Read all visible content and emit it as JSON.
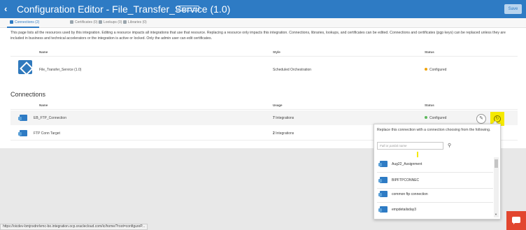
{
  "header": {
    "back_icon": "chevron-left-icon",
    "title": "Configuration Editor - File_Transfer_Service (1.0)",
    "badge": "INTEGRATION",
    "save_label": "Save"
  },
  "tabs": [
    {
      "label": "Connections (2)",
      "icon": "connections-icon"
    },
    {
      "label": "Certificates (0)",
      "icon": "certificate-icon"
    },
    {
      "label": "Lookups (0)",
      "icon": "lookup-icon"
    },
    {
      "label": "Libraries (0)",
      "icon": "library-icon"
    }
  ],
  "description": "This page lists all the resources used by this integration. Editing a resource impacts all integrations that use that resource. Replacing a resource only impacts this integration. Connections, libraries, lookups, and certificates can be edited. Connections and certificates (pgp keys) can be replaced unless they are included in business and technical accelerators or the integration is active or locked. Only the admin user can edit certificates.",
  "integration_table": {
    "columns": [
      "Name",
      "Style",
      "Status"
    ],
    "row": {
      "name": "File_Transfer_Service (1.0)",
      "style": "Scheduled Orchestration",
      "status": "Configured",
      "status_color": "#f0a30a"
    }
  },
  "connections": {
    "title": "Connections",
    "columns": [
      "Name",
      "Usage",
      "Status"
    ],
    "rows": [
      {
        "name": "EB_FTP_Connection",
        "usage_count": "7",
        "usage_label": "Integrations",
        "status": "Configured",
        "status_color": "#5cb85c"
      },
      {
        "name": "FTP Conn Target",
        "usage_count": "2",
        "usage_label": "Integrations",
        "status": "",
        "status_color": ""
      }
    ]
  },
  "replace_popup": {
    "text": "Replace this connection with a connection choosing from the following.",
    "search_placeholder": "Full or partial name",
    "search_value": "",
    "items": [
      "Aug22_Assignment",
      "BIPFTPCONNEC",
      "common ftp connection",
      "empdetailsday3"
    ]
  },
  "status_url": "https://oicdev-bmjnxdnrlvmc-bo.integration.ocp.oraclecloud.com/ic/home/?root=configureP...",
  "colors": {
    "accent": "#2e7bc4",
    "highlight": "#f5e900",
    "chat": "#e2462f"
  }
}
